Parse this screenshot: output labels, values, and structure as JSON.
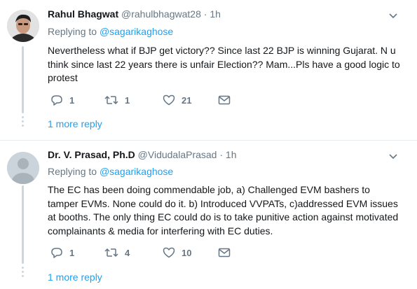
{
  "tweets": [
    {
      "name": "Rahul Bhagwat",
      "handle": "@rahulbhagwat28",
      "separator": "·",
      "time": "1h",
      "replying_prefix": "Replying to",
      "replying_to": "@sagarikaghose",
      "text": "Nevertheless what if BJP get victory?? Since last 22 BJP is winning Gujarat. N u think since last 22 years there is unfair Election?? Mam...Pls have a good logic to protest",
      "replies": "1",
      "retweets": "1",
      "likes": "21",
      "more_replies": "1 more reply"
    },
    {
      "name": "Dr. V. Prasad, Ph.D",
      "handle": "@VidudalaPrasad",
      "separator": "·",
      "time": "1h",
      "replying_prefix": "Replying to",
      "replying_to": "@sagarikaghose",
      "text": "The EC has been doing  commendable job, a) Challenged EVM bashers to tamper EVMs. None could do it. b) Introduced VVPATs, c)addressed EVM issues at booths. The only thing EC could do is to take punitive action against motivated complainants & media for interfering with EC duties.",
      "replies": "1",
      "retweets": "4",
      "likes": "10",
      "more_replies": "1 more reply"
    }
  ],
  "icons": {
    "reply": "reply-icon",
    "retweet": "retweet-icon",
    "like": "heart-icon",
    "message": "envelope-icon",
    "menu": "chevron-down-icon"
  },
  "colors": {
    "link": "#1da1f2",
    "muted": "#657786",
    "thread": "#ccd6dd"
  }
}
